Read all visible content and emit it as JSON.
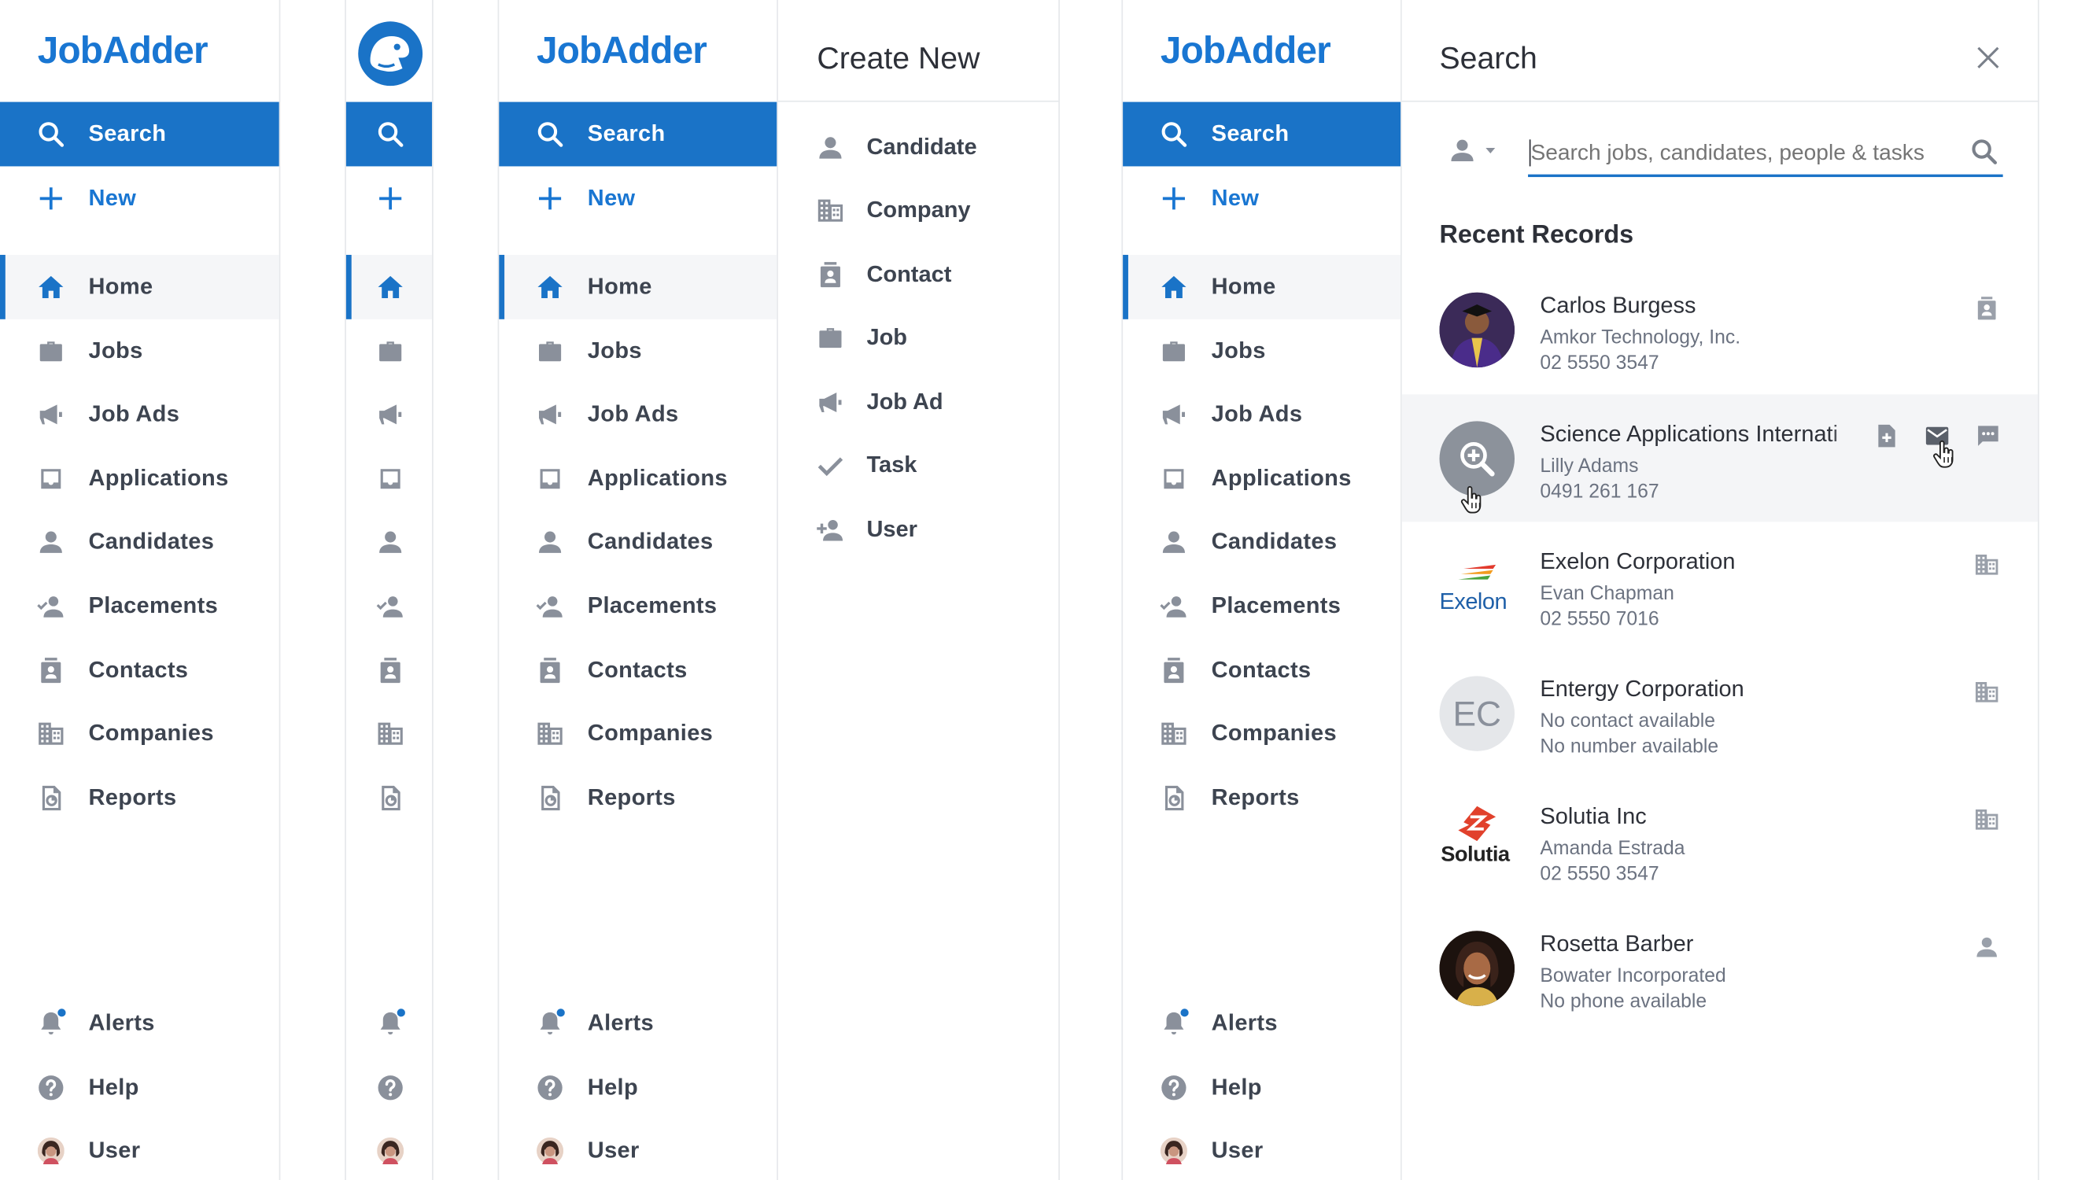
{
  "brand": {
    "logo_part1": "Job",
    "logo_part2": "Adder"
  },
  "nav": {
    "search": "Search",
    "new": "New",
    "items": [
      {
        "label": "Home",
        "icon": "home-icon"
      },
      {
        "label": "Jobs",
        "icon": "briefcase-icon"
      },
      {
        "label": "Job Ads",
        "icon": "megaphone-icon"
      },
      {
        "label": "Applications",
        "icon": "inbox-icon"
      },
      {
        "label": "Candidates",
        "icon": "person-icon"
      },
      {
        "label": "Placements",
        "icon": "person-check-icon"
      },
      {
        "label": "Contacts",
        "icon": "contact-card-icon"
      },
      {
        "label": "Companies",
        "icon": "building-icon"
      },
      {
        "label": "Reports",
        "icon": "report-icon"
      }
    ],
    "bottom": [
      {
        "label": "Alerts",
        "icon": "bell-icon"
      },
      {
        "label": "Help",
        "icon": "help-icon"
      },
      {
        "label": "User",
        "icon": "avatar"
      }
    ]
  },
  "create_new": {
    "title": "Create New",
    "items": [
      "Candidate",
      "Company",
      "Contact",
      "Job",
      "Job Ad",
      "Task",
      "User"
    ]
  },
  "search_panel": {
    "title": "Search",
    "placeholder": "Search jobs, candidates, people & tasks",
    "recent_title": "Recent Records",
    "records": [
      {
        "name": "Carlos Burgess",
        "line1": "Amkor Technology, Inc.",
        "line2": "02 5550 3547",
        "type_icon": "contact-card-icon"
      },
      {
        "name": "Science Applications Internati",
        "line1": "Lilly Adams",
        "line2": "0491 261 167",
        "type_icon": "add-document-icon"
      },
      {
        "name": "Exelon Corporation",
        "line1": "Evan Chapman",
        "line2": "02 5550 7016",
        "type_icon": "building-icon",
        "logo_text": "Exelon"
      },
      {
        "name": "Entergy Corporation",
        "line1": "No contact available",
        "line2": "No number available",
        "type_icon": "building-icon",
        "initials": "EC"
      },
      {
        "name": "Solutia Inc",
        "line1": "Amanda Estrada",
        "line2": "02 5550 3547",
        "type_icon": "building-icon",
        "logo_text": "Solutia"
      },
      {
        "name": "Rosetta Barber",
        "line1": "Bowater Incorporated",
        "line2": "No phone available",
        "type_icon": "person-icon"
      }
    ]
  },
  "colors": {
    "accent": "#1a73c7",
    "icon_grey": "#8a909b",
    "text": "#3d4450"
  }
}
